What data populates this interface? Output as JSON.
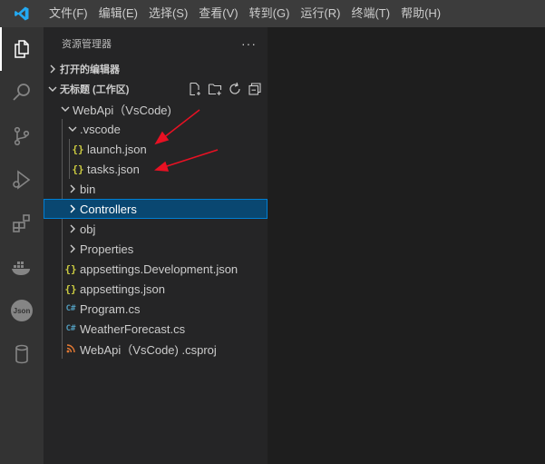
{
  "menu": [
    "文件(F)",
    "编辑(E)",
    "选择(S)",
    "查看(V)",
    "转到(G)",
    "运行(R)",
    "终端(T)",
    "帮助(H)"
  ],
  "sidebar": {
    "title": "资源管理器",
    "more": "···",
    "open_editors": "打开的编辑器",
    "workspace": "无标题 (工作区)"
  },
  "tree": {
    "root": "WebApi（VsCode)",
    "vscode": ".vscode",
    "launch": "launch.json",
    "tasks": "tasks.json",
    "bin": "bin",
    "controllers": "Controllers",
    "obj": "obj",
    "properties": "Properties",
    "appsettings_dev": "appsettings.Development.json",
    "appsettings": "appsettings.json",
    "program": "Program.cs",
    "weather": "WeatherForecast.cs",
    "csproj": "WebApi（VsCode) .csproj"
  },
  "icons": {
    "json": "{}",
    "cs": "C#",
    "rss": "rss"
  },
  "colors": {
    "accent": "#007fd4",
    "selection": "#094771",
    "arrow": "#e81123"
  }
}
